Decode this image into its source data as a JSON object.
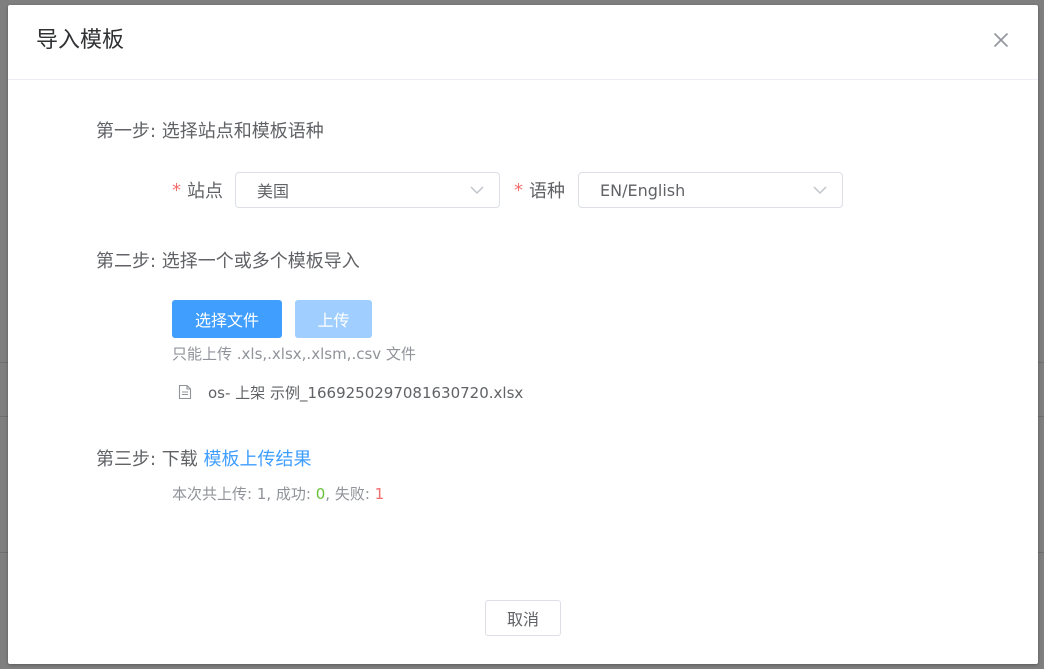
{
  "dialog": {
    "title": "导入模板"
  },
  "step1": {
    "label": "第一步:  选择站点和模板语种",
    "site": {
      "required_mark": "*",
      "label": "站点",
      "value": "美国"
    },
    "language": {
      "required_mark": "*",
      "label": "语种",
      "value": "EN/English"
    }
  },
  "step2": {
    "label": "第二步:  选择一个或多个模板导入",
    "select_file_button": "选择文件",
    "upload_button": "上传",
    "upload_tip": "只能上传 .xls,.xlsx,.xlsm,.csv 文件",
    "files": [
      {
        "name": "os- 上架 示例_1669250297081630720.xlsx"
      }
    ]
  },
  "step3": {
    "label": "第三步:  下载 ",
    "download_link": "模板上传结果",
    "result_prefix": "本次共上传: 1, 成功: ",
    "success_count": "0",
    "result_middle": ", 失败: ",
    "fail_count": "1"
  },
  "footer": {
    "cancel_button": "取消"
  },
  "icons": {
    "close": "close-icon",
    "dropdown": "chevron-down-icon",
    "file": "document-icon"
  },
  "colors": {
    "primary": "#409eff",
    "primary_disabled": "#a0cfff",
    "required": "#f56c6c",
    "success": "#67c23a",
    "fail": "#f56c6c"
  }
}
